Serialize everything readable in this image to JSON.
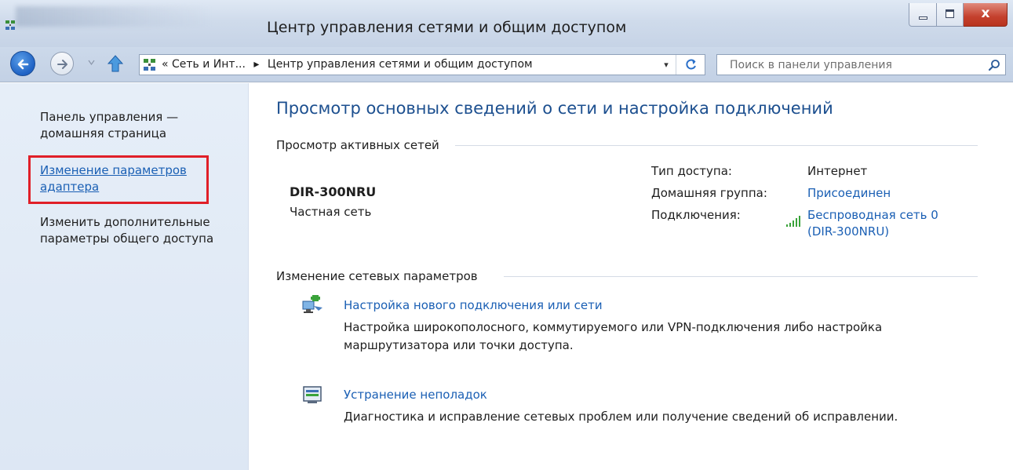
{
  "window": {
    "title": "Центр управления сетями и общим доступом",
    "close_label": "x"
  },
  "nav": {
    "breadcrumbs": [
      "« Сеть и Инт...",
      "▸",
      "Центр управления сетями и общим доступом"
    ],
    "search_placeholder": "Поиск в панели управления"
  },
  "sidebar": {
    "items": [
      {
        "label": "Панель управления — домашняя страница"
      },
      {
        "label": "Изменение параметров адаптера"
      },
      {
        "label": "Изменить дополнительные параметры общего доступа"
      }
    ]
  },
  "main": {
    "title": "Просмотр основных сведений о сети и настройка подключений",
    "active_networks_header": "Просмотр активных сетей",
    "network": {
      "name": "DIR-300NRU",
      "type": "Частная сеть"
    },
    "properties": [
      {
        "label": "Тип доступа:",
        "value": "Интернет"
      },
      {
        "label": "Домашняя группа:",
        "value": "Присоединен"
      },
      {
        "label": "Подключения:",
        "value": "Беспроводная сеть 0",
        "value2": "(DIR-300NRU)"
      }
    ],
    "change_settings_header": "Изменение сетевых параметров",
    "tasks": [
      {
        "icon": "network-setup-icon",
        "title": "Настройка нового подключения или сети",
        "description": "Настройка широкополосного, коммутируемого или VPN-подключения либо настройка маршрутизатора или точки доступа."
      },
      {
        "icon": "troubleshoot-icon",
        "title": "Устранение неполадок",
        "description": "Диагностика и исправление сетевых проблем или получение сведений об исправлении."
      }
    ]
  },
  "colors": {
    "link": "#1a5fb4",
    "title": "#1c4f8f",
    "highlight": "#e01f28",
    "sidebar_bg": "#e3ecf7"
  }
}
